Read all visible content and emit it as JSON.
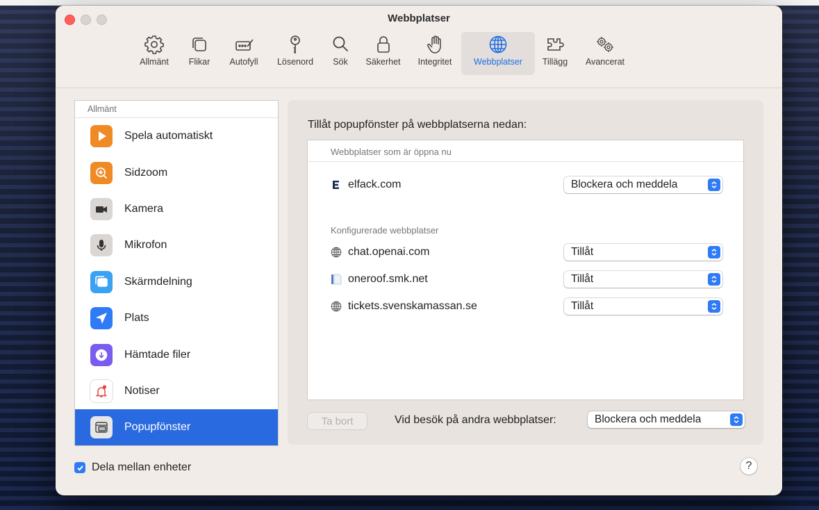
{
  "window": {
    "title": "Webbplatser"
  },
  "toolbar": {
    "items": [
      {
        "label": "Allmänt",
        "icon": "gear-icon"
      },
      {
        "label": "Flikar",
        "icon": "tabs-icon"
      },
      {
        "label": "Autofyll",
        "icon": "autofill-icon"
      },
      {
        "label": "Lösenord",
        "icon": "key-icon"
      },
      {
        "label": "Sök",
        "icon": "search-icon"
      },
      {
        "label": "Säkerhet",
        "icon": "lock-icon"
      },
      {
        "label": "Integritet",
        "icon": "hand-icon"
      },
      {
        "label": "Webbplatser",
        "icon": "globe-icon",
        "selected": true
      },
      {
        "label": "Tillägg",
        "icon": "puzzle-icon"
      },
      {
        "label": "Avancerat",
        "icon": "gears-icon"
      }
    ]
  },
  "sidebar": {
    "header": "Allmänt",
    "items": [
      {
        "label": "Spela automatiskt",
        "icon": "play-icon",
        "color": "#f08a24"
      },
      {
        "label": "Sidzoom",
        "icon": "zoom-icon",
        "color": "#f08a24"
      },
      {
        "label": "Kamera",
        "icon": "camera-icon",
        "color": "#c9c6c3"
      },
      {
        "label": "Mikrofon",
        "icon": "microphone-icon",
        "color": "#c9c6c3"
      },
      {
        "label": "Skärmdelning",
        "icon": "screen-sharing-icon",
        "color": "#3aa2f2"
      },
      {
        "label": "Plats",
        "icon": "location-icon",
        "color": "#2f7bf5"
      },
      {
        "label": "Hämtade filer",
        "icon": "download-icon",
        "color": "#7a5cf0"
      },
      {
        "label": "Notiser",
        "icon": "bell-icon",
        "color": "#ffffff"
      },
      {
        "label": "Popupfönster",
        "icon": "popup-window-icon",
        "color": "#e6e6e6",
        "selected": true
      }
    ]
  },
  "main": {
    "heading": "Tillåt popupfönster på webbplatserna nedan:",
    "open_section": "Webbplatser som är öppna nu",
    "open_sites": [
      {
        "name": "elfack.com",
        "icon": "elfack-favicon",
        "setting": "Blockera och meddela"
      }
    ],
    "configured_section": "Konfigurerade webbplatser",
    "configured_sites": [
      {
        "name": "chat.openai.com",
        "icon": "globe-icon",
        "setting": "Tillåt"
      },
      {
        "name": "oneroof.smk.net",
        "icon": "document-icon",
        "setting": "Tillåt"
      },
      {
        "name": "tickets.svenskamassan.se",
        "icon": "globe-icon",
        "setting": "Tillåt"
      }
    ],
    "remove_button": "Ta bort",
    "other_sites_label": "Vid besök på andra webbplatser:",
    "other_sites_setting": "Blockera och meddela"
  },
  "footer": {
    "share_label": "Dela mellan enheter",
    "share_checked": true,
    "help_label": "?"
  },
  "colors": {
    "accent": "#2f7bf5",
    "selection": "#2a6ae0"
  }
}
